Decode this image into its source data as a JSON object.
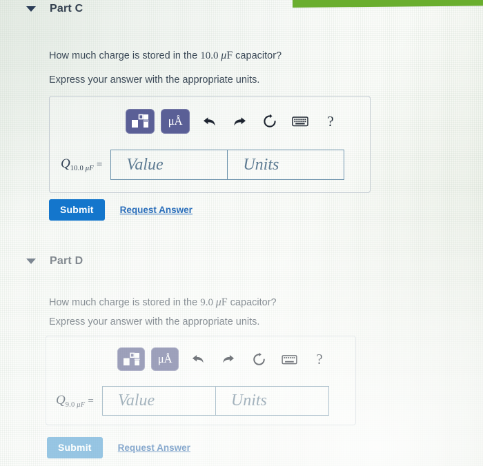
{
  "page": {
    "background_color": "#fbfcfa",
    "accent_color": "#1476cc",
    "toolbar_button_color": "#5a5f96",
    "top_bar_color": "#6aae2e",
    "field_border_color": "#6d93ad"
  },
  "parts": [
    {
      "id": "part-c",
      "caret_icon": "caret-down-icon",
      "title": "Part C",
      "question": {
        "prefix": "How much charge is stored in the ",
        "value": "10.0 ",
        "unit_mu": "μ",
        "unit_f": "F",
        "suffix": " capacitor?"
      },
      "instruction": "Express your answer with the appropriate units.",
      "toolbar": {
        "template_button_icon": "math-template-icon",
        "units_button_label": "μÅ",
        "units_button_icon": "units-icon",
        "undo_icon": "undo-arrow-icon",
        "redo_icon": "redo-arrow-icon",
        "reset_icon": "reset-circular-arrow-icon",
        "keyboard_icon": "keyboard-icon",
        "help_label": "?",
        "help_icon": "help-question-icon"
      },
      "answer": {
        "symbol": "Q",
        "subscript_value": "10.0 ",
        "subscript_mu": "μ",
        "subscript_f": "F",
        "equals": "=",
        "value_placeholder": "Value",
        "units_placeholder": "Units"
      },
      "actions": {
        "submit_label": "Submit",
        "request_answer_label": "Request Answer"
      }
    },
    {
      "id": "part-d",
      "caret_icon": "caret-down-icon",
      "title": "Part D",
      "question": {
        "prefix": "How much charge is stored in the  ",
        "value": "9.0 ",
        "unit_mu": "μ",
        "unit_f": "F",
        "suffix": " capacitor?"
      },
      "instruction": "Express your answer with the appropriate units.",
      "toolbar": {
        "template_button_icon": "math-template-icon",
        "units_button_label": "μÅ",
        "units_button_icon": "units-icon",
        "undo_icon": "undo-arrow-icon",
        "redo_icon": "redo-arrow-icon",
        "reset_icon": "reset-circular-arrow-icon",
        "keyboard_icon": "keyboard-icon",
        "help_label": "?",
        "help_icon": "help-question-icon"
      },
      "answer": {
        "symbol": "Q",
        "subscript_value": "9.0 ",
        "subscript_mu": "μ",
        "subscript_f": "F",
        "equals": "=",
        "value_placeholder": "Value",
        "units_placeholder": "Units"
      },
      "actions": {
        "submit_label": "Submit",
        "request_answer_label": "Request Answer"
      }
    }
  ]
}
